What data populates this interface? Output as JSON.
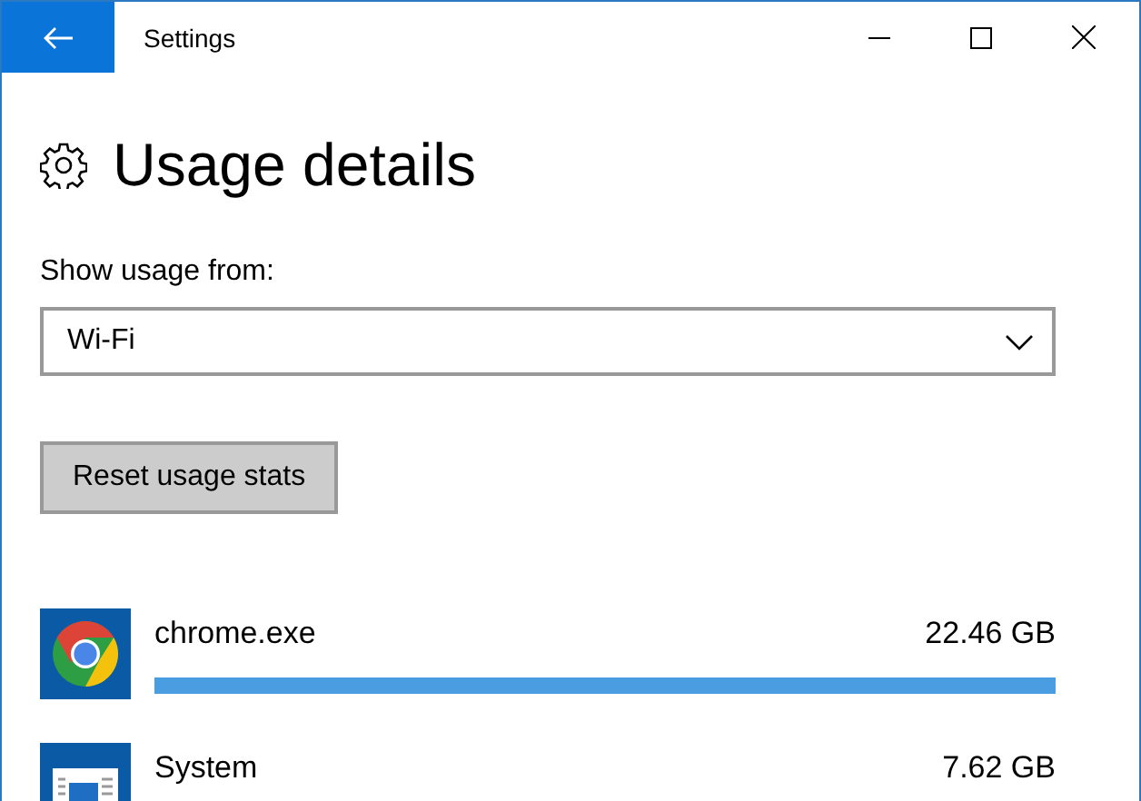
{
  "window": {
    "title": "Settings"
  },
  "page": {
    "title": "Usage details"
  },
  "usage_from": {
    "label": "Show usage from:",
    "value": "Wi-Fi"
  },
  "reset_button": {
    "label": "Reset usage stats"
  },
  "apps": [
    {
      "name": "chrome.exe",
      "usage": "22.46 GB",
      "kind": "chrome",
      "level": 1
    },
    {
      "name": "System",
      "usage": "7.62 GB",
      "kind": "system"
    }
  ]
}
